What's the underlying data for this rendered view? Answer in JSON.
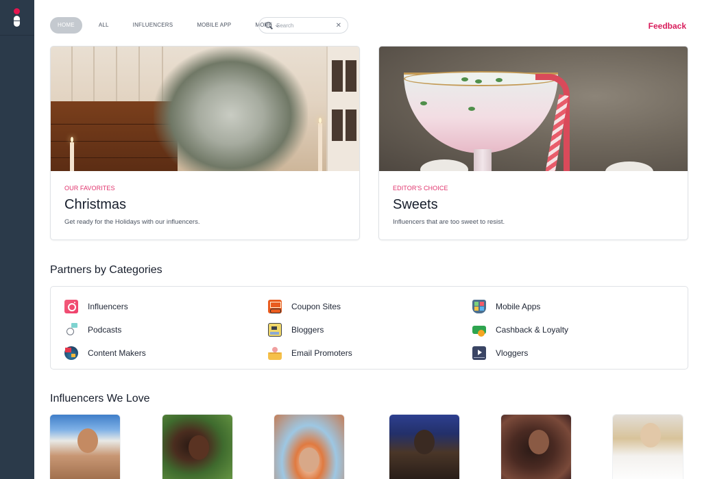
{
  "brand": {
    "accent": "#e5154f",
    "sidebar_bg": "#2b3a4a",
    "link_color": "#d81b5a"
  },
  "nav": {
    "items": [
      {
        "label": "HOME",
        "active": true
      },
      {
        "label": "ALL",
        "active": false
      },
      {
        "label": "INFLUENCERS",
        "active": false
      },
      {
        "label": "MOBILE APP",
        "active": false
      },
      {
        "label": "MORE",
        "active": false,
        "has_dropdown": true
      }
    ],
    "search": {
      "placeholder": "Search",
      "value": "",
      "clear_icon": "close-icon"
    },
    "feedback_label": "Feedback"
  },
  "featured": [
    {
      "eyebrow": "OUR FAVORITES",
      "title": "Christmas",
      "description": "Get ready for the Holidays with our influencers.",
      "image": "christmas-tree-photo"
    },
    {
      "eyebrow": "EDITOR'S CHOICE",
      "title": "Sweets",
      "description": "Influencers that are too sweet to resist.",
      "image": "candy-cane-cocktail-photo"
    }
  ],
  "partners": {
    "title": "Partners by Categories",
    "categories": [
      {
        "label": "Influencers",
        "icon": "instagram-icon"
      },
      {
        "label": "Podcasts",
        "icon": "microphone-icon"
      },
      {
        "label": "Content Makers",
        "icon": "content-maker-icon"
      },
      {
        "label": "Coupon Sites",
        "icon": "coupon-icon"
      },
      {
        "label": "Bloggers",
        "icon": "blog-icon"
      },
      {
        "label": "Email Promoters",
        "icon": "email-icon"
      },
      {
        "label": "Mobile Apps",
        "icon": "mobile-apps-icon"
      },
      {
        "label": "Cashback & Loyalty",
        "icon": "cashback-icon"
      },
      {
        "label": "Vloggers",
        "icon": "video-icon"
      }
    ]
  },
  "influencers": {
    "title": "Influencers We Love",
    "items": [
      {
        "image": "influencer-photo-1"
      },
      {
        "image": "influencer-photo-2"
      },
      {
        "image": "influencer-photo-3"
      },
      {
        "image": "influencer-photo-4"
      },
      {
        "image": "influencer-photo-5"
      },
      {
        "image": "influencer-photo-6"
      }
    ]
  }
}
